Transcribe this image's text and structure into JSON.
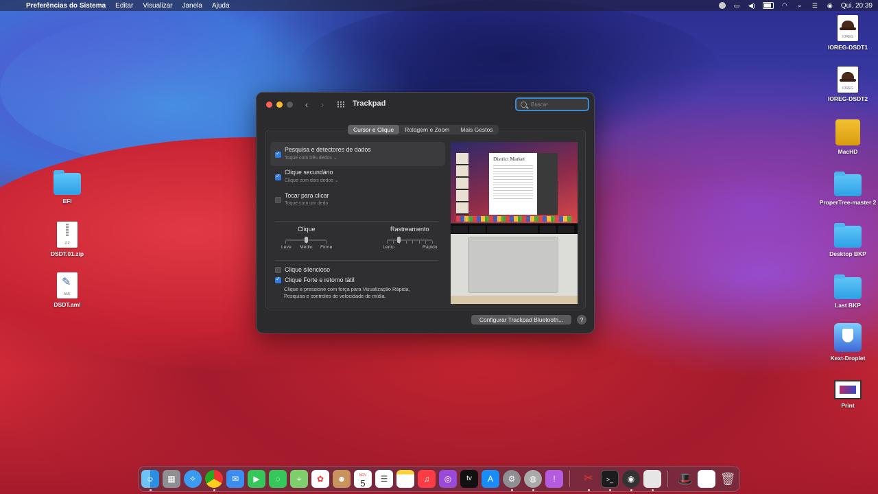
{
  "menubar": {
    "app": "Preferências do Sistema",
    "menus": [
      "Editar",
      "Visualizar",
      "Janela",
      "Ajuda"
    ],
    "clock": "Qui. 20:39"
  },
  "desktop": {
    "left_icons": [
      {
        "label": "EFI"
      },
      {
        "label": "DSDT.01.zip",
        "badge": "ZIP"
      },
      {
        "label": "DSDT.aml",
        "badge": "AML"
      }
    ],
    "right_icons": [
      {
        "label": "IOREG-DSDT1",
        "badge": "IOREG"
      },
      {
        "label": "IOREG-DSDT2",
        "badge": "IOREG"
      },
      {
        "label": "MacHD"
      },
      {
        "label": "ProperTree-master 2"
      },
      {
        "label": "Desktop BKP"
      },
      {
        "label": "Last BKP"
      },
      {
        "label": "Kext-Droplet"
      },
      {
        "label": "Print"
      }
    ]
  },
  "window": {
    "title": "Trackpad",
    "search_placeholder": "Buscar",
    "tabs": [
      "Cursor e Clique",
      "Rolagem e Zoom",
      "Mais Gestos"
    ],
    "options": [
      {
        "title": "Pesquisa e detectores de dados",
        "subtitle": "Toque com três dedos ⌄",
        "checked": true
      },
      {
        "title": "Clique secundário",
        "subtitle": "Clique com dois dedos ⌄",
        "checked": true
      },
      {
        "title": "Tocar para clicar",
        "subtitle": "Toque com um dedo",
        "checked": false
      }
    ],
    "click_slider": {
      "title": "Clique",
      "labels": [
        "Leve",
        "Médio",
        "Firme"
      ],
      "value": "Médio"
    },
    "tracking_slider": {
      "title": "Rastreamento",
      "labels": [
        "Lento",
        "Rápido"
      ],
      "value_fraction": 0.25
    },
    "silent_click": {
      "title": "Clique silencioso",
      "checked": false
    },
    "force_click": {
      "title": "Clique Forte e retorno tátil",
      "checked": true,
      "description": "Clique e pressione com força para Visualização Rápida, Pesquisa e controles de velocidade de mídia."
    },
    "preview": {
      "page_title": "District Market"
    },
    "bluetooth_button": "Configurar Trackpad Bluetooth...",
    "help_button": "?"
  },
  "dock": {
    "apps": [
      "finder",
      "launchpad",
      "safari",
      "chrome",
      "mail",
      "facetime",
      "messages",
      "maps",
      "photos",
      "contacts",
      "calendar",
      "reminders",
      "notes",
      "music",
      "podcasts",
      "tv",
      "app-store",
      "system-preferences",
      "disk-utility",
      "feedback",
      "swiss-knife",
      "terminal",
      "disk-tool",
      "blank-app",
      "ioreg",
      "print",
      "trash"
    ],
    "calendar_month": "NOV",
    "calendar_day": "5",
    "tv_label": "tv"
  },
  "colors": {
    "accent": "#2f7be0",
    "search_focus": "#3a8bd6"
  }
}
